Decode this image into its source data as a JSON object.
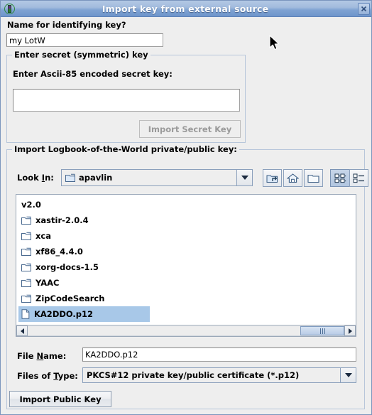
{
  "window": {
    "title": "Import key from external source",
    "icon": "key-app-icon",
    "close_label": "close-icon"
  },
  "name_section": {
    "label": "Name for identifying key?",
    "value": "my LotW",
    "placeholder": ""
  },
  "secret_section": {
    "group_title": "Enter secret (symmetric) key",
    "field_label": "Enter Ascii-85 encoded secret key:",
    "value": "",
    "placeholder": "",
    "import_button": "Import Secret Key",
    "import_button_enabled": false
  },
  "filechooser": {
    "group_title": "Import Logbook-of-the-World private/public key:",
    "look_in_label": "Look In:",
    "look_in_label_mnemonic": "I",
    "look_in_value": "apavlin",
    "toolbar": [
      {
        "name": "up-one-level-icon",
        "tooltip": "Up One Level"
      },
      {
        "name": "home-icon",
        "tooltip": "Home"
      },
      {
        "name": "create-new-folder-icon",
        "tooltip": "Create New Folder"
      },
      {
        "name": "list-view-icon",
        "tooltip": "List",
        "selected": true
      },
      {
        "name": "details-view-icon",
        "tooltip": "Details",
        "selected": false
      }
    ],
    "columns": [
      {
        "items": [
          {
            "label": "v2.0",
            "type": "folder",
            "icon": false,
            "selected": false
          }
        ]
      },
      {
        "items": [
          {
            "label": "xastir-2.0.4",
            "type": "folder",
            "icon": true,
            "selected": false
          },
          {
            "label": "xca",
            "type": "folder",
            "icon": true,
            "selected": false
          },
          {
            "label": "xf86_4.4.0",
            "type": "folder",
            "icon": true,
            "selected": false
          },
          {
            "label": "xorg-docs-1.5",
            "type": "folder",
            "icon": true,
            "selected": false
          },
          {
            "label": "YAAC",
            "type": "folder",
            "icon": true,
            "selected": false
          },
          {
            "label": "ZipCodeSearch",
            "type": "folder",
            "icon": true,
            "selected": false
          },
          {
            "label": "KA2DDO.p12",
            "type": "file",
            "icon": true,
            "selected": true
          }
        ]
      }
    ],
    "scrollbar": {
      "orientation": "horizontal",
      "thumb_position": "right"
    },
    "file_name_label": "File Name:",
    "file_name_label_mnemonic": "N",
    "file_name_value": "KA2DDO.p12",
    "files_of_type_label": "Files of Type:",
    "files_of_type_label_mnemonic": "T",
    "files_of_type_value": "PKCS#12 private key/public certificate (*.p12)",
    "import_button": "Import Public Key"
  },
  "colors": {
    "titlebar_top": "#b3c8e4",
    "titlebar_bottom": "#6e95cb",
    "dialog_bg": "#eeeeee",
    "selection": "#a8c8e8",
    "group_border": "#b7c6da",
    "folder_icon": "#c9dcf2"
  }
}
